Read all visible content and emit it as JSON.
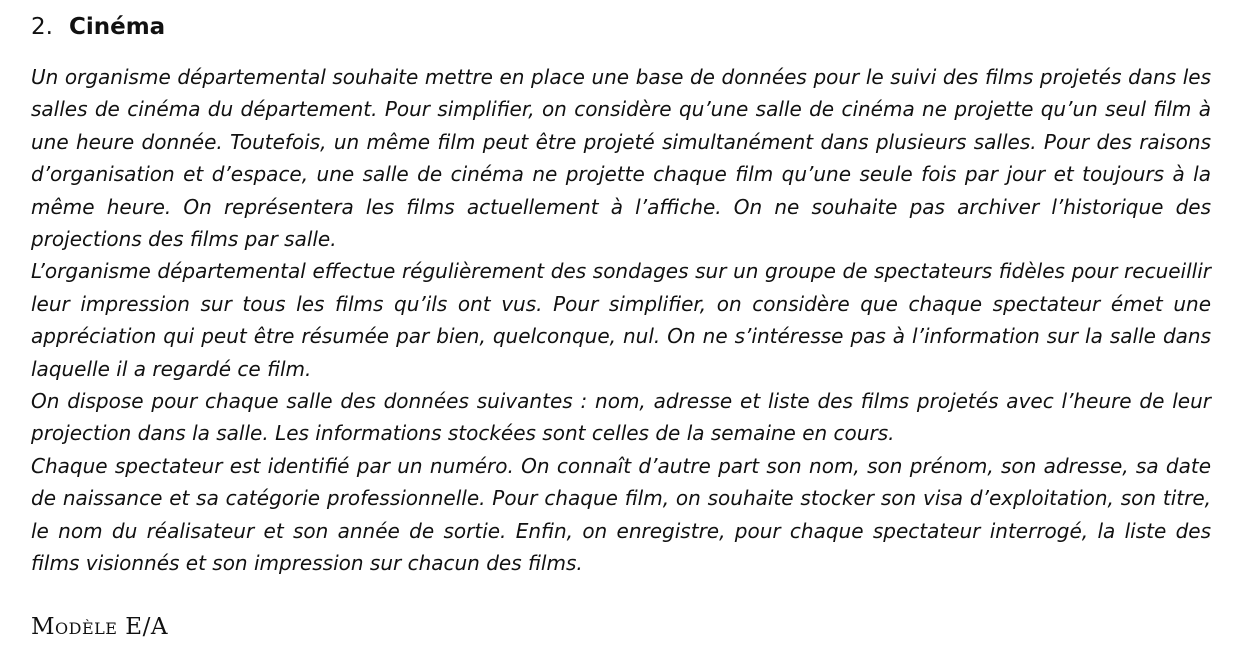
{
  "section": {
    "number": "2.",
    "title": "Cinéma"
  },
  "paragraphs": [
    "Un organisme départemental souhaite mettre en place une base de données pour le suivi des films projetés dans les salles de cinéma du département. Pour simplifier, on considère qu’une salle de cinéma ne projette qu’un seul film à une heure donnée. Toutefois, un même film peut être projeté simultanément dans plusieurs salles. Pour des raisons d’organisation et d’espace, une salle de cinéma ne projette chaque film qu’une seule fois par jour et toujours à la même heure. On représentera les films actuellement à l’affiche. On ne souhaite pas archiver l’historique des projections des films par salle.",
    "L’organisme départemental effectue régulièrement des sondages sur un groupe de spectateurs fidèles pour recueillir leur impression sur tous les films qu’ils ont vus. Pour simplifier, on considère que chaque spectateur émet une appréciation qui peut être résumée par bien, quelconque, nul. On ne s’intéresse pas à l’information sur la salle dans laquelle il a regardé ce film.",
    "On dispose pour chaque salle des données suivantes : nom, adresse et liste des films projetés avec l’heure de leur projection dans la salle. Les informations stockées sont celles de la semaine en cours.",
    "Chaque spectateur est identifié par un numéro. On connaît d’autre part son nom, son prénom, son adresse, sa date de naissance et sa catégorie professionnelle. Pour chaque film, on souhaite stocker son visa d’exploitation, son titre, le nom du réalisateur et son année de sortie. Enfin, on enregistre, pour chaque spectateur interrogé, la liste des films visionnés et son impression sur chacun des films."
  ],
  "subsection_label": "Modèle E/A"
}
